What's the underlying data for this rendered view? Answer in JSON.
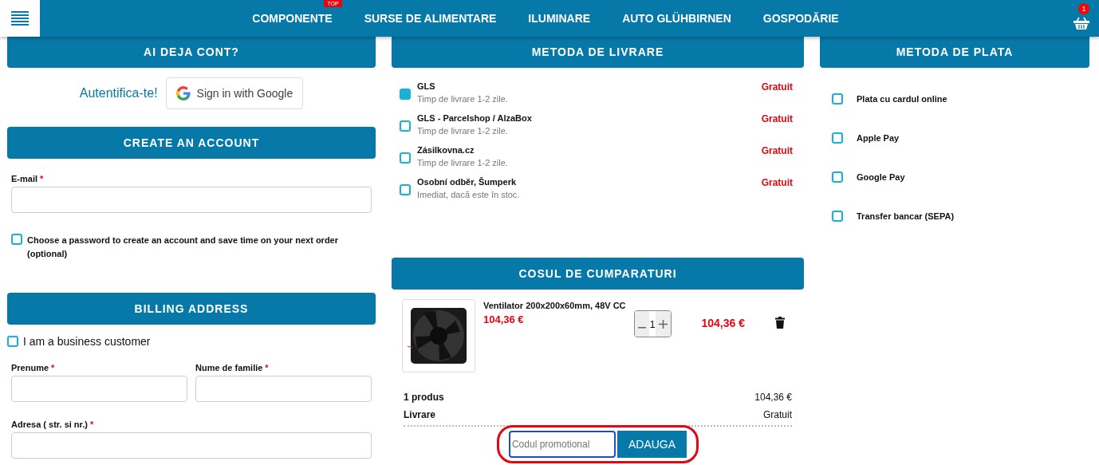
{
  "nav": {
    "items": [
      {
        "label": "COMPONENTE",
        "badge": "TOP"
      },
      {
        "label": "SURSE DE ALIMENTARE"
      },
      {
        "label": "ILUMINARE"
      },
      {
        "label": "AUTO GLÜHBIRNEN"
      },
      {
        "label": "GOSPODĂRIE"
      }
    ],
    "cart_count": "1"
  },
  "account": {
    "title": "AI DEJA CONT?",
    "login_link": "Autentifica-te!",
    "google_button": "Sign in with Google"
  },
  "create_account": {
    "title": "CREATE AN ACCOUNT",
    "email_label": "E-mail",
    "required_mark": "*",
    "password_option": {
      "label": "Choose a password to create an account and save time on your next order (optional)",
      "checked": false
    }
  },
  "billing": {
    "title": "BILLING ADDRESS",
    "business": {
      "label": "I am a business customer",
      "checked": false
    },
    "fields": [
      {
        "label": "Prenume",
        "kind": "half"
      },
      {
        "label": "Nume de familie",
        "kind": "half"
      },
      {
        "label": "Adresa ( str. si nr.)",
        "kind": "full"
      }
    ]
  },
  "delivery": {
    "title": "METODA DE LIVRARE",
    "methods": [
      {
        "name": "GLS",
        "note": "Timp de livrare 1-2 zile.",
        "price": "Gratuit",
        "selected": true
      },
      {
        "name": "GLS - Parcelshop / AlzaBox",
        "note": "Timp de livrare 1-2 zile.",
        "price": "Gratuit",
        "selected": false
      },
      {
        "name": "Zásilkovna.cz",
        "note": "Timp de livrare 1-2 zile.",
        "price": "Gratuit",
        "selected": false
      },
      {
        "name": "Osobní odběr, Šumperk",
        "note": "Imediat, dacă este în stoc.",
        "price": "Gratuit",
        "selected": false
      }
    ]
  },
  "payment": {
    "title": "METODA DE PLATA",
    "methods": [
      {
        "name": "Plata cu cardul online",
        "selected": false
      },
      {
        "name": "Apple Pay",
        "selected": false
      },
      {
        "name": "Google Pay",
        "selected": false
      },
      {
        "name": "Transfer bancar (SEPA)",
        "selected": false
      }
    ]
  },
  "cart": {
    "title": "COSUL DE CUMPARATURI",
    "items": [
      {
        "name": "Ventilator 200x200x60mm, 48V CC",
        "price": "104,36 €",
        "quantity": "1",
        "total": "104,36 €"
      }
    ],
    "summary": [
      {
        "label": "1 produs",
        "value": "104,36 €"
      },
      {
        "label": "Livrare",
        "value": "Gratuit"
      }
    ],
    "promo": {
      "placeholder": "Codul promotional",
      "button": "ADAUGA",
      "highlighted": true
    }
  }
}
